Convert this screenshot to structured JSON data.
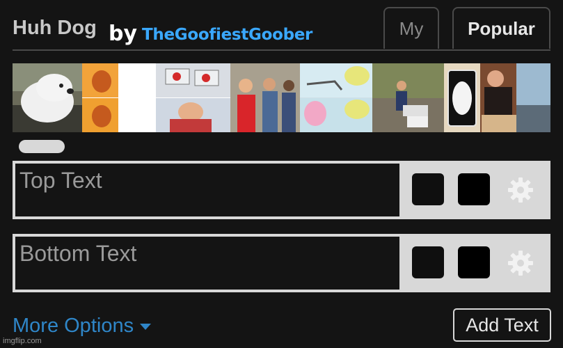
{
  "header": {
    "title": "Huh Dog",
    "by": "by",
    "author": "TheGoofiestGoober"
  },
  "tabs": [
    {
      "label": "My"
    },
    {
      "label": "Popular"
    }
  ],
  "templates": [
    {
      "icon": "dog-meme-thumbnail"
    },
    {
      "icon": "drake-meme-thumbnail"
    },
    {
      "icon": "two-buttons-meme-thumbnail"
    },
    {
      "icon": "distracted-boyfriend-meme-thumbnail"
    },
    {
      "icon": "epic-handshake-meme-thumbnail"
    },
    {
      "icon": "change-my-mind-meme-thumbnail"
    },
    {
      "icon": "uno-draw-25-meme-thumbnail"
    },
    {
      "icon": "partial-thumbnail"
    }
  ],
  "text_boxes": [
    {
      "placeholder": "Top Text"
    },
    {
      "placeholder": "Bottom Text"
    }
  ],
  "footer": {
    "more_options": "More Options",
    "add_text": "Add Text",
    "watermark": "imgflip.com"
  },
  "colors": {
    "background": "#141414",
    "accent": "#2f86c8",
    "author": "#3aa8ff"
  }
}
